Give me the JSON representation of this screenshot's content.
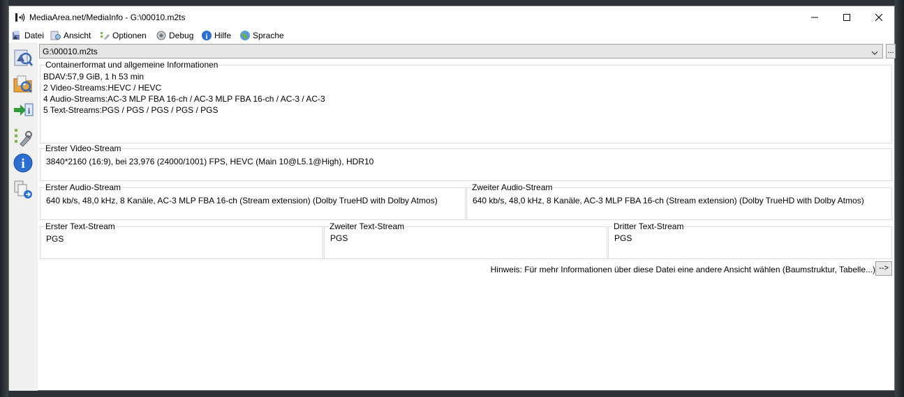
{
  "window": {
    "title": "MediaArea.net/MediaInfo - G:\\00010.m2ts"
  },
  "menu": [
    {
      "label": "Datei",
      "icon": "datei-icon"
    },
    {
      "label": "Ansicht",
      "icon": "ansicht-icon"
    },
    {
      "label": "Optionen",
      "icon": "optionen-icon"
    },
    {
      "label": "Debug",
      "icon": "debug-icon"
    },
    {
      "label": "Hilfe",
      "icon": "hilfe-icon"
    },
    {
      "label": "Sprache",
      "icon": "sprache-icon"
    }
  ],
  "toolbar": {
    "buttons": [
      "open-file-icon",
      "open-folder-icon",
      "export-icon",
      "preferences-icon",
      "about-icon",
      "compare-icon"
    ]
  },
  "file_select": {
    "value": "G:\\00010.m2ts",
    "browse_label": "..."
  },
  "general": {
    "legend": "Containerformat und allgemeine Informationen",
    "lines": [
      "BDAV:57,9 GiB, 1 h 53 min",
      "2 Video-Streams:HEVC / HEVC",
      "4 Audio-Streams:AC-3 MLP FBA 16-ch / AC-3 MLP FBA 16-ch / AC-3 / AC-3",
      "5 Text-Streams:PGS / PGS / PGS / PGS / PGS"
    ]
  },
  "video1": {
    "legend": "Erster Video-Stream",
    "text": "3840*2160 (16:9), bei 23,976 (24000/1001) FPS, HEVC (Main 10@L5.1@High), HDR10"
  },
  "audio1": {
    "legend": "Erster Audio-Stream",
    "text": "640 kb/s, 48,0 kHz, 8 Kanäle, AC-3 MLP FBA 16-ch (Stream extension) (Dolby TrueHD with Dolby Atmos)"
  },
  "audio2": {
    "legend": "Zweiter Audio-Stream",
    "text": "640 kb/s, 48,0 kHz, 8 Kanäle, AC-3 MLP FBA 16-ch (Stream extension) (Dolby TrueHD with Dolby Atmos)"
  },
  "text1": {
    "legend": "Erster Text-Stream",
    "text": "PGS"
  },
  "text2": {
    "legend": "Zweiter Text-Stream",
    "text": "PGS"
  },
  "text3": {
    "legend": "Dritter Text-Stream",
    "text": "PGS"
  },
  "hint": {
    "text": "Hinweis: Für mehr Informationen über diese Datei eine andere Ansicht wählen (Baumstruktur, Tabelle...)",
    "button_label": "-->"
  },
  "colors": {
    "titlebar_bg": "#ffffff",
    "toolbar_bg": "#f0f0f0",
    "group_border": "#dcdcdc"
  }
}
